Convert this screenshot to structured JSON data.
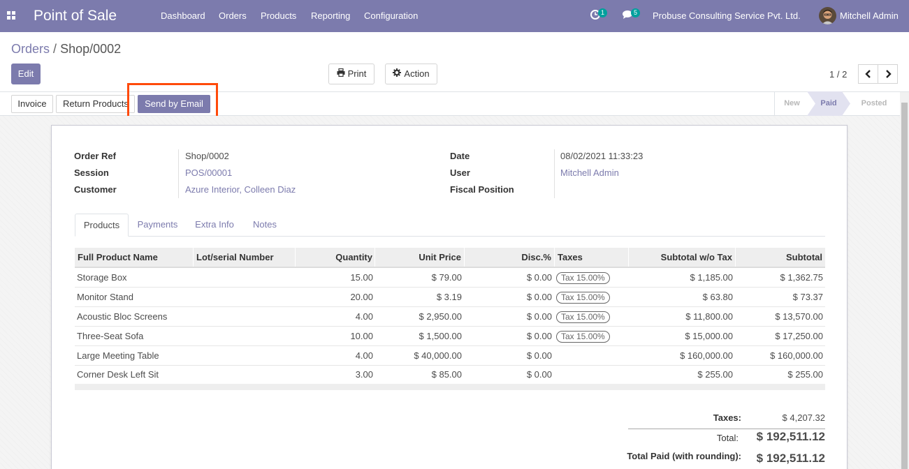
{
  "navbar": {
    "app_title": "Point of Sale",
    "menu": [
      "Dashboard",
      "Orders",
      "Products",
      "Reporting",
      "Configuration"
    ],
    "activity_count": "1",
    "message_count": "5",
    "company": "Probuse Consulting Service Pvt. Ltd.",
    "user": "Mitchell Admin"
  },
  "breadcrumb": {
    "parent": "Orders",
    "separator": "/",
    "current": "Shop/0002"
  },
  "toolbar": {
    "edit": "Edit",
    "print": "Print",
    "action": "Action"
  },
  "pager": {
    "value": "1 / 2"
  },
  "statusbar": {
    "buttons": [
      "Invoice",
      "Return Products",
      "Send by Email"
    ],
    "stages": [
      "New",
      "Paid",
      "Posted"
    ],
    "active_stage": "Paid"
  },
  "form": {
    "order_ref_label": "Order Ref",
    "order_ref": "Shop/0002",
    "session_label": "Session",
    "session": "POS/00001",
    "customer_label": "Customer",
    "customer": "Azure Interior, Colleen Diaz",
    "date_label": "Date",
    "date": "08/02/2021 11:33:23",
    "user_label": "User",
    "user": "Mitchell Admin",
    "fiscal_position_label": "Fiscal Position",
    "fiscal_position": ""
  },
  "tabs": [
    "Products",
    "Payments",
    "Extra Info",
    "Notes"
  ],
  "lines": {
    "headers": [
      "Full Product Name",
      "Lot/serial Number",
      "Quantity",
      "Unit Price",
      "Disc.%",
      "Taxes",
      "Subtotal w/o Tax",
      "Subtotal"
    ],
    "rows": [
      {
        "name": "Storage Box",
        "lot": "",
        "qty": "15.00",
        "price": "$ 79.00",
        "disc": "$ 0.00",
        "tax": "Tax 15.00%",
        "subtotal_wo_tax": "$ 1,185.00",
        "subtotal": "$ 1,362.75"
      },
      {
        "name": "Monitor Stand",
        "lot": "",
        "qty": "20.00",
        "price": "$ 3.19",
        "disc": "$ 0.00",
        "tax": "Tax 15.00%",
        "subtotal_wo_tax": "$ 63.80",
        "subtotal": "$ 73.37"
      },
      {
        "name": "Acoustic Bloc Screens",
        "lot": "",
        "qty": "4.00",
        "price": "$ 2,950.00",
        "disc": "$ 0.00",
        "tax": "Tax 15.00%",
        "subtotal_wo_tax": "$ 11,800.00",
        "subtotal": "$ 13,570.00"
      },
      {
        "name": "Three-Seat Sofa",
        "lot": "",
        "qty": "10.00",
        "price": "$ 1,500.00",
        "disc": "$ 0.00",
        "tax": "Tax 15.00%",
        "subtotal_wo_tax": "$ 15,000.00",
        "subtotal": "$ 17,250.00"
      },
      {
        "name": "Large Meeting Table",
        "lot": "",
        "qty": "4.00",
        "price": "$ 40,000.00",
        "disc": "$ 0.00",
        "tax": "",
        "subtotal_wo_tax": "$ 160,000.00",
        "subtotal": "$ 160,000.00"
      },
      {
        "name": "Corner Desk Left Sit",
        "lot": "",
        "qty": "3.00",
        "price": "$ 85.00",
        "disc": "$ 0.00",
        "tax": "",
        "subtotal_wo_tax": "$ 255.00",
        "subtotal": "$ 255.00"
      }
    ]
  },
  "totals": {
    "taxes_label": "Taxes:",
    "taxes": "$ 4,207.32",
    "total_label": "Total:",
    "total": "$ 192,511.12",
    "total_paid_label": "Total Paid (with rounding):",
    "total_paid": "$ 192,511.12"
  },
  "colors": {
    "brand": "#7c7bad",
    "highlight": "#ff4a0a",
    "badge": "#00a09d"
  }
}
